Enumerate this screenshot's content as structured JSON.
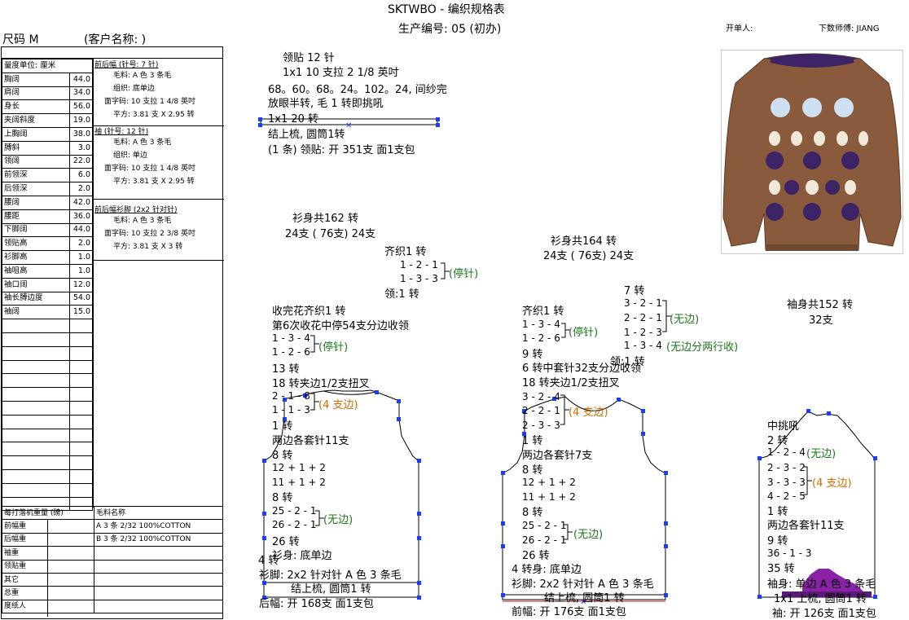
{
  "header": {
    "title": "SKTWBO - 编织规格表",
    "production_no": "生产编号: 05 (初办)",
    "order_by": "开单人:",
    "calc_by": "下数师傅: JIANG",
    "size": "尺码  M",
    "customer": "(客户名称:                    )"
  },
  "measurements": {
    "unit": "量度单位: 厘米",
    "rows": [
      {
        "label": "胸阔",
        "value": "44.0"
      },
      {
        "label": "肩阔",
        "value": "34.0"
      },
      {
        "label": "身长",
        "value": "56.0"
      },
      {
        "label": "夹阔斜度",
        "value": "19.0"
      },
      {
        "label": "上胸阔",
        "value": "38.0"
      },
      {
        "label": "膊斜",
        "value": "3.0"
      },
      {
        "label": "领阔",
        "value": "22.0"
      },
      {
        "label": "前领深",
        "value": "6.0"
      },
      {
        "label": "后领深",
        "value": "2.0"
      },
      {
        "label": "腰阔",
        "value": "42.0"
      },
      {
        "label": "腰距",
        "value": "36.0"
      },
      {
        "label": "下脚阔",
        "value": "44.0"
      },
      {
        "label": "领贴高",
        "value": "2.0"
      },
      {
        "label": "衫脚高",
        "value": "1.0"
      },
      {
        "label": "袖咀高",
        "value": "1.0"
      },
      {
        "label": "袖口阔",
        "value": "12.0"
      },
      {
        "label": "袖长膊边度",
        "value": "54.0"
      },
      {
        "label": "袖阔",
        "value": "15.0"
      },
      {
        "label": "",
        "value": ""
      },
      {
        "label": "",
        "value": ""
      },
      {
        "label": "",
        "value": ""
      },
      {
        "label": "",
        "value": ""
      },
      {
        "label": "",
        "value": ""
      },
      {
        "label": "",
        "value": ""
      },
      {
        "label": "",
        "value": ""
      },
      {
        "label": "",
        "value": ""
      },
      {
        "label": "",
        "value": ""
      },
      {
        "label": "",
        "value": ""
      },
      {
        "label": "",
        "value": ""
      },
      {
        "label": "",
        "value": ""
      },
      {
        "label": "",
        "value": ""
      },
      {
        "label": "",
        "value": ""
      }
    ]
  },
  "specs": {
    "s1_title": "前后幅 (针号: 7 针)",
    "s1_lines": [
      "毛料: A 色 3 条毛",
      "组织: 底单边",
      "面字码: 10 支拉 1 4/8 英吋",
      "平方: 3.81 支 X  2.95 转"
    ],
    "s2_title": "袖 (针号: 12 针)",
    "s2_lines": [
      "毛料: A 色 3 条毛",
      "组织: 单边",
      "面字码: 10 支拉 1 4/8 英吋",
      "平方: 3.81 支 X  2.95 转"
    ],
    "s3_title": "前后幅衫脚 (2x2  针对针)",
    "s3_lines": [
      "毛料: A 色 3 条毛",
      "面字码: 10 支拉 2 3/8 英吋",
      "平方: 3.81 支 X  3 转"
    ]
  },
  "weights": {
    "header_label": "每打落机重量 (磅)",
    "header_yarn": "毛料名称",
    "rows": [
      {
        "label": "前幅重",
        "yarn": "A  3 条 2/32  100%COTTON"
      },
      {
        "label": "后幅重",
        "yarn": "B  3 条 2/32  100%COTTON"
      },
      {
        "label": "袖重",
        "yarn": ""
      },
      {
        "label": "领贴重",
        "yarn": ""
      },
      {
        "label": "其它",
        "yarn": ""
      },
      {
        "label": "总重",
        "yarn": ""
      },
      {
        "label": "度纸人",
        "yarn": ""
      }
    ]
  },
  "collar": {
    "l1": "领贴  12 针",
    "l2": "1x1   10 支拉 2 1/8 英吋",
    "l3": "68。60。68。24。102。24, 间纱完",
    "l4": "放眼半转, 毛 1 转即挑吼",
    "l5": "1x1       20 转",
    "l6": "结上梳, 圆筒1转",
    "l7": "(1 条) 领贴: 开 351支 面1支包"
  },
  "back": {
    "total": "衫身共162 转",
    "split": "24支 ( 76支) 24支",
    "even1": "齐织1 转",
    "r1": "1 - 2 - 1",
    "r2": "1 - 3 - 3",
    "stop": "(停针)",
    "neck1": "领:1 转",
    "a1": "收完花齐织1 转",
    "a2": "第6次收花中停54支分边收领",
    "a3": "1 - 3 - 4",
    "a4": "1 - 2 - 6",
    "a5": "13 转",
    "a6": "18 转夹边1/2支扭叉",
    "a7": "2 - 1 - 8",
    "a8": "1 - 1 - 3",
    "a8tag": "(4 支边)",
    "a9": "1 转",
    "a10": "两边各套针11支",
    "a11": "8 转",
    "a12": "12 + 1 + 2",
    "a13": "11 + 1 + 2",
    "a14": "8 转",
    "a15": "25 - 2 - 1",
    "a16": "26 - 2 - 1",
    "a16tag": "(无边)",
    "a17": "26 转",
    "a18": "衫身: 底单边",
    "a18pre": "4 转",
    "a19": "衫脚: 2x2  针对针   A 色 3 条毛",
    "a20": "结上梳, 圆筒1 转",
    "a21": "后幅: 开 168支 面1支包"
  },
  "front": {
    "total": "衫身共164 转",
    "split": "24支 ( 76支) 24支",
    "c1": "7 转",
    "c2": "3 - 2 - 1",
    "c3": "2 - 2 - 1",
    "c3tag": "(无边)",
    "c4": "1 - 2 - 3",
    "c5": "1 - 3 - 4",
    "c5tag": "(无边分两行收)",
    "b1": "齐织1 转",
    "b2": "1 - 3 - 4",
    "b3": "1 - 2 - 6",
    "b23tag": "(停针)",
    "b4": "9 转",
    "b5": "6 转中套针32支分边收领",
    "b5b": "领:1 转",
    "b6": "18 转夹边1/2支扭叉",
    "b7": "3 - 2 - 4",
    "b8": "2 - 2 - 1",
    "b8tag": "(4 支边)",
    "b9": "2 - 3 - 3",
    "b10": "1 转",
    "b11": "两边各套针7支",
    "b12": "8 转",
    "b13": "12 + 1 + 2",
    "b14": "11 + 1 + 2",
    "b15": "8 转",
    "b16": "25 - 2 - 1",
    "b17": "26 - 2 - 1",
    "b17tag": "(无边)",
    "b18": "26 转",
    "b19": "4 转身: 底单边",
    "b20": "衫脚: 2x2  针对针   A 色 3 条毛",
    "b21": "结上梳, 圆筒1 转",
    "b22": "前幅: 开 176支 面1支包"
  },
  "sleeve": {
    "total": "袖身共152 转",
    "n": "32支",
    "d1": "中挑吼",
    "d2": "2 转",
    "d3": "1 - 2 - 4",
    "d3tag": "(无边)",
    "d4": "2 - 3 - 2",
    "d5": "3 - 3 - 3",
    "d5tag": "(4 支边)",
    "d6": "4 - 2 - 5",
    "d7": "1 转",
    "d8": "两边各套针11支",
    "d9": "9 转",
    "d10": "36 - 1 - 3",
    "d11": "35 转",
    "d12": "袖身: 单边 A 色 3 条毛",
    "d13": "1x1 上梳, 圆筒1 转",
    "d14": "袖: 开 126支 面1支包"
  },
  "colors": {
    "sweater": "#8a5a3c",
    "purple": "#3d2466",
    "outline": "#000000",
    "handle": "#1a3cff"
  }
}
